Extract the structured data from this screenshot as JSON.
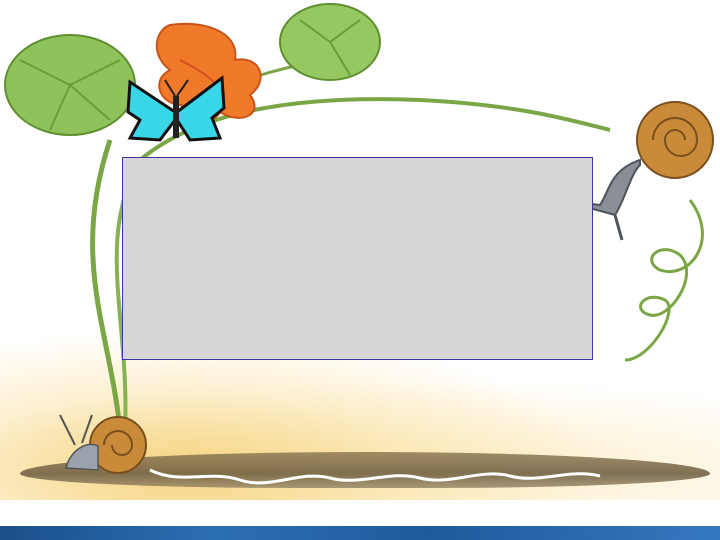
{
  "colors": {
    "panel_fill": "#d6d6d6",
    "panel_border": "#3a3aa0",
    "stem_green": "#7aa646",
    "leaf_green": "#8fc25a",
    "flower_orange": "#f07a2a",
    "butterfly_cyan": "#38d6e6",
    "snail_shell": "#c98a3a",
    "bottom_bar": "#1f5a9c"
  },
  "icons": [
    "butterfly-icon",
    "snail-icon",
    "flower-icon",
    "leaf-icon"
  ]
}
